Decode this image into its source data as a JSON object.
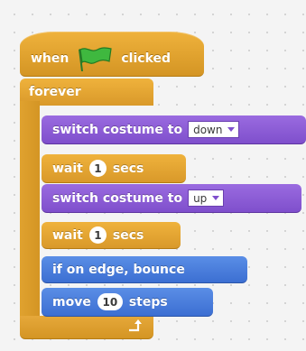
{
  "script": {
    "hat": {
      "when_label": "when",
      "clicked_label": "clicked",
      "icon": "green-flag-icon",
      "flag_color": "#33aa33"
    },
    "forever": {
      "label": "forever",
      "icon": "loop-arrow-icon"
    },
    "blocks": [
      {
        "text": "switch costume to",
        "dropdown": "down",
        "category": "looks"
      },
      {
        "text_before": "wait",
        "value": "1",
        "text_after": "secs",
        "category": "control"
      },
      {
        "text": "switch costume to",
        "dropdown": "up",
        "category": "looks"
      },
      {
        "text_before": "wait",
        "value": "1",
        "text_after": "secs",
        "category": "control"
      },
      {
        "text": "if on edge, bounce",
        "category": "motion"
      },
      {
        "text_before": "move",
        "value": "10",
        "text_after": "steps",
        "category": "motion"
      }
    ]
  },
  "colors": {
    "control": "#e6a530",
    "looks": "#8a5cd6",
    "motion": "#4a7ddc",
    "background": "#f4f4f4"
  }
}
